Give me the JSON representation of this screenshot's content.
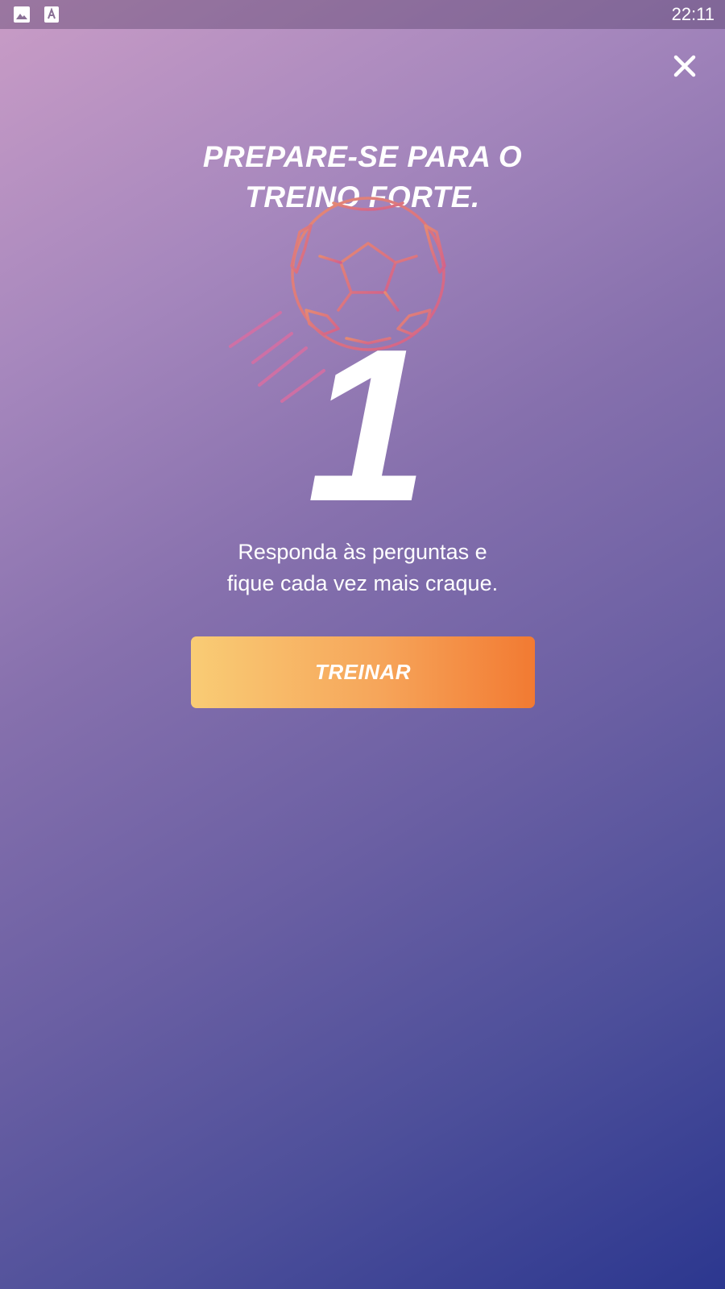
{
  "status_bar": {
    "time": "22:11",
    "icons": [
      "image-icon",
      "font-icon"
    ]
  },
  "dialog": {
    "close_icon": "close-icon",
    "title_line1": "PREPARE-SE PARA O",
    "title_line2": "TREINO FORTE.",
    "illustration": "soccer-ball-icon",
    "countdown": "1",
    "subtitle_line1": "Responda às perguntas e",
    "subtitle_line2": "fique cada vez mais craque.",
    "button_label": "TREINAR"
  },
  "colors": {
    "background_top": "#c99cc6",
    "background_bottom": "#2c378f",
    "button_start": "#f9cc75",
    "button_end": "#f27a32",
    "ball_stroke": "#e07a78"
  }
}
